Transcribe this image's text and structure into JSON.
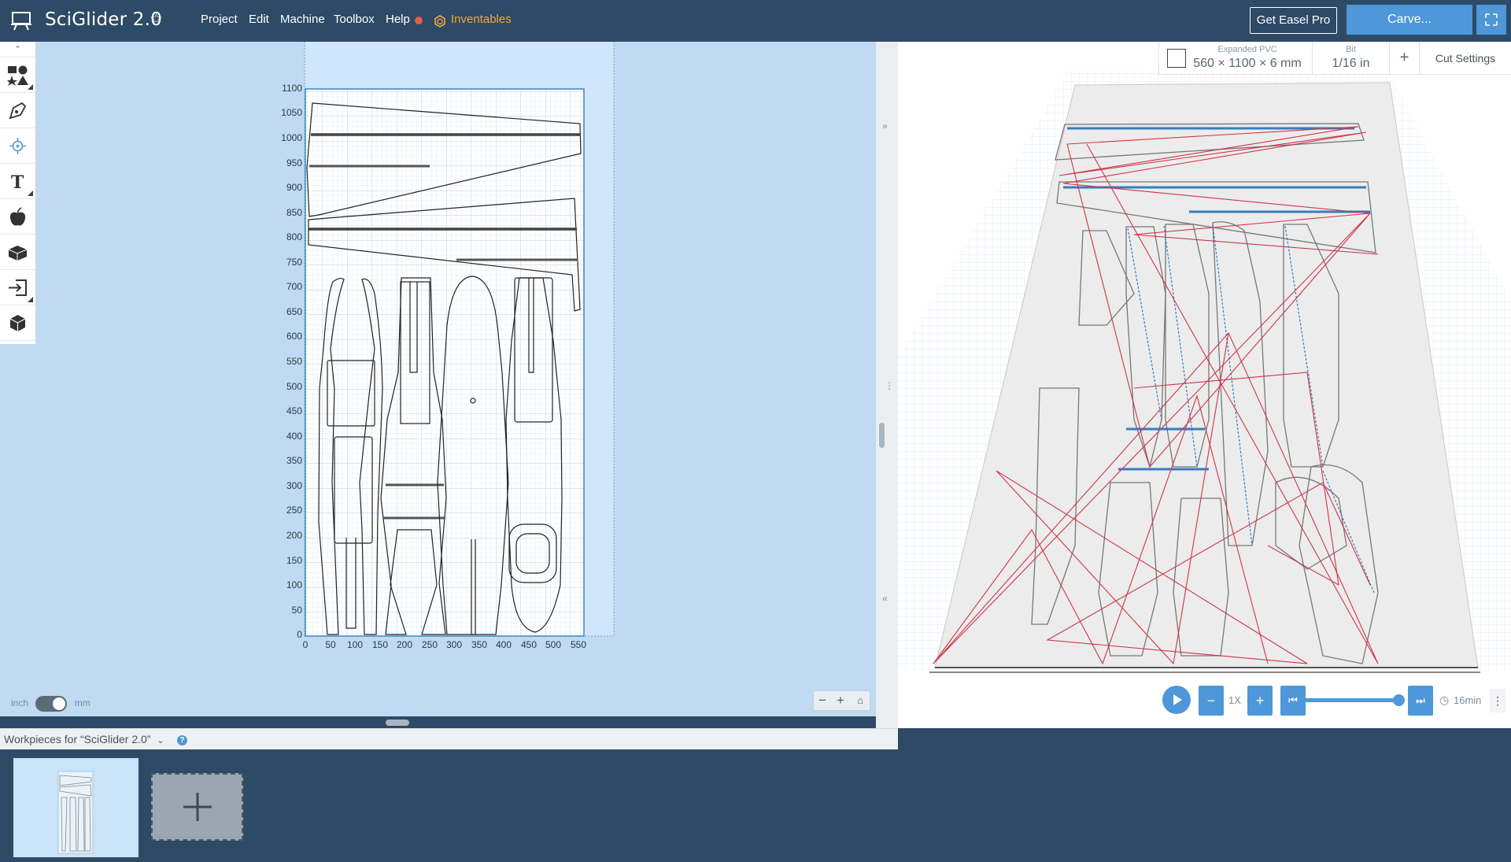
{
  "header": {
    "app_title": "SciGlider 2.0",
    "menu": [
      "Project",
      "Edit",
      "Machine",
      "Toolbox",
      "Help"
    ],
    "inventables_label": "Inventables",
    "get_pro_label": "Get Easel Pro",
    "carve_label": "Carve..."
  },
  "canvas": {
    "y_ticks": [
      "1100",
      "1050",
      "1000",
      "950",
      "900",
      "850",
      "800",
      "750",
      "700",
      "650",
      "600",
      "550",
      "500",
      "450",
      "400",
      "350",
      "300",
      "250",
      "200",
      "150",
      "100",
      "50",
      "0"
    ],
    "x_ticks": [
      "0",
      "50",
      "100",
      "150",
      "200",
      "250",
      "300",
      "350",
      "400",
      "450",
      "500",
      "550"
    ],
    "unit_left": "inch",
    "unit_right": "mm",
    "unit_selected": "mm"
  },
  "tools": [
    "shapes-icon",
    "pen-icon",
    "point-icon",
    "text-icon",
    "apps-icon",
    "parts-icon",
    "import-icon",
    "3d-icon"
  ],
  "material": {
    "name": "Expanded PVC",
    "dimensions": "560 × 1100 × 6 mm",
    "bit_label": "Bit",
    "bit_value": "1/16 in",
    "add_label": "+",
    "cut_settings_label": "Cut Settings"
  },
  "playback": {
    "speed": "1X",
    "progress": 1.0,
    "time_estimate": "16min"
  },
  "workpieces": {
    "label": "Workpieces for “SciGlider 2.0”",
    "help": "?"
  },
  "colors": {
    "header_bg": "#2d4a66",
    "accent": "#4e97d8",
    "inventables": "#f3a93b",
    "travel_path": "#d0344a",
    "cut_path": "#3a7bbd"
  }
}
